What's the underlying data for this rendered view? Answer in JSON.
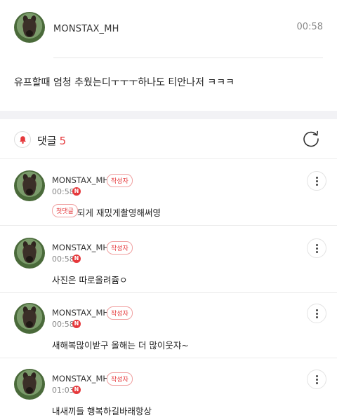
{
  "post": {
    "author": "MONSTAX_MH",
    "time": "00:58",
    "body": "유프할때 엄청 추웠는디ㅜㅜㅜ하나도 티안나저 ㅋㅋㅋ"
  },
  "comments_section": {
    "title": "댓글",
    "count": "5",
    "bell_icon": "bell-icon",
    "refresh_icon": "refresh-icon"
  },
  "comments": [
    {
      "author": "MONSTAX_MH",
      "badge": "작성자",
      "time": "00:58",
      "new_label": "N",
      "first_label": "첫댓글",
      "text": "되게 재밌게촬영해써영"
    },
    {
      "author": "MONSTAX_MH",
      "badge": "작성자",
      "time": "00:58",
      "new_label": "N",
      "text": "사진은 따로올려쥼ㅇ"
    },
    {
      "author": "MONSTAX_MH",
      "badge": "작성자",
      "time": "00:58",
      "new_label": "N",
      "text": "새해복많이받구 올해는 더 많이웃쟈~"
    },
    {
      "author": "MONSTAX_MH",
      "badge": "작성자",
      "time": "01:03",
      "new_label": "N",
      "text": "내새끼들 행복하길바래항상"
    }
  ],
  "colors": {
    "accent": "#e5383b",
    "divider": "#ececec",
    "section_gap": "#f2f2f5"
  }
}
